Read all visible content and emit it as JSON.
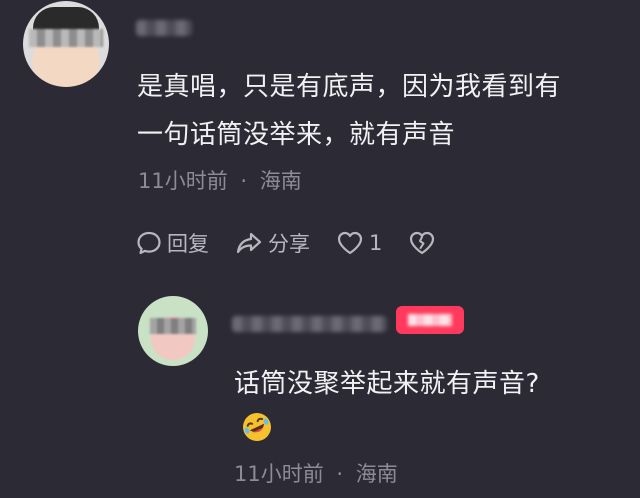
{
  "comment": {
    "text_line1": "是真唱，只是有底声，因为我看到有",
    "text_line2": "一句话筒没举来，就有声音",
    "time": "11小时前",
    "separator": "·",
    "location": "海南",
    "actions": {
      "reply_label": "回复",
      "share_label": "分享",
      "like_count": "1"
    }
  },
  "reply": {
    "text": "话筒没聚举起来就有声音?",
    "emoji": "rolling-on-floor-laughing-emoji",
    "time": "11小时前",
    "separator": "·",
    "location": "海南"
  },
  "colors": {
    "background": "#2b2a35",
    "text": "#f1f1f4",
    "meta": "#8c8b96",
    "author_tag": "#ff3a5c"
  }
}
